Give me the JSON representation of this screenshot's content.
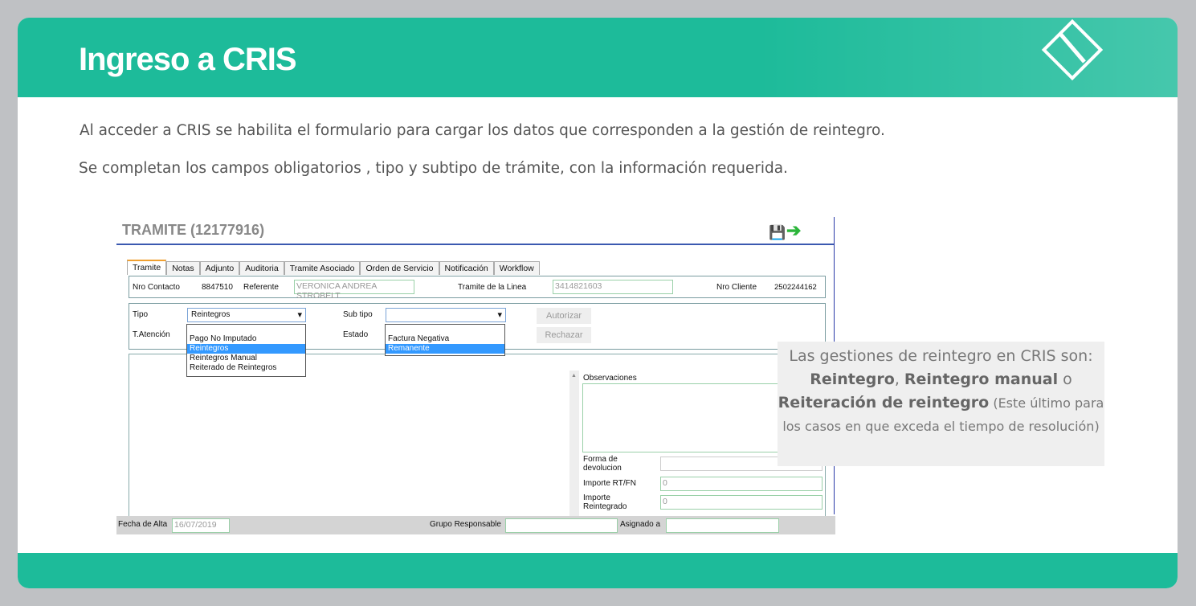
{
  "slide": {
    "title": "Ingreso a CRIS",
    "p1": "Al acceder a CRIS se habilita el formulario para cargar los datos que corresponden a la gestión de reintegro.",
    "p2": "Se completan los campos obligatorios , tipo y subtipo  de trámite, con la información requerida."
  },
  "form": {
    "title": "TRAMITE (12177916)",
    "tabs": [
      "Tramite",
      "Notas",
      "Adjunto",
      "Auditoria",
      "Tramite Asociado",
      "Orden de Servicio",
      "Notificación",
      "Workflow"
    ],
    "nro_contacto_label": "Nro Contacto",
    "nro_contacto": "8847510",
    "referente_label": "Referente",
    "referente": "VERONICA ANDREA STROBELT",
    "tramite_linea_label": "Tramite de la Linea",
    "tramite_linea": "3414821603",
    "nro_cliente_label": "Nro Cliente",
    "nro_cliente": "2502244162",
    "tipo_label": "Tipo",
    "tipo": "Reintegros",
    "subtipo_label": "Sub tipo",
    "subtipo": "",
    "t_atencion_label": "T.Atención",
    "estado_label": "Estado",
    "tipo_options": [
      "Pago No Imputado",
      "Reintegros",
      "Reintegros Manual",
      "Reiterado de Reintegros"
    ],
    "subtipo_options": [
      "Factura Negativa",
      "Remanente"
    ],
    "autorizar": "Autorizar",
    "rechazar": "Rechazar",
    "observaciones_label": "Observaciones",
    "forma_label": "Forma de devolucion",
    "importe_rt_label": "Importe RT/FN",
    "importe_rt": "0",
    "importe_reint_label": "Importe Reintegrado",
    "importe_reint": "0",
    "fecha_alta_label": "Fecha de Alta",
    "fecha_alta": "16/07/2019",
    "grupo_label": "Grupo Responsable",
    "asignado_label": "Asignado a"
  },
  "note": {
    "t1": "Las gestiones de reintegro en CRIS son: ",
    "b1": "Reintegro",
    "t2": ", ",
    "b2": "Reintegro manual",
    "t3": " o ",
    "b3": "Reiteración de reintegro",
    "t4": "  (Este último para los casos en que exceda el tiempo de resolución)"
  }
}
